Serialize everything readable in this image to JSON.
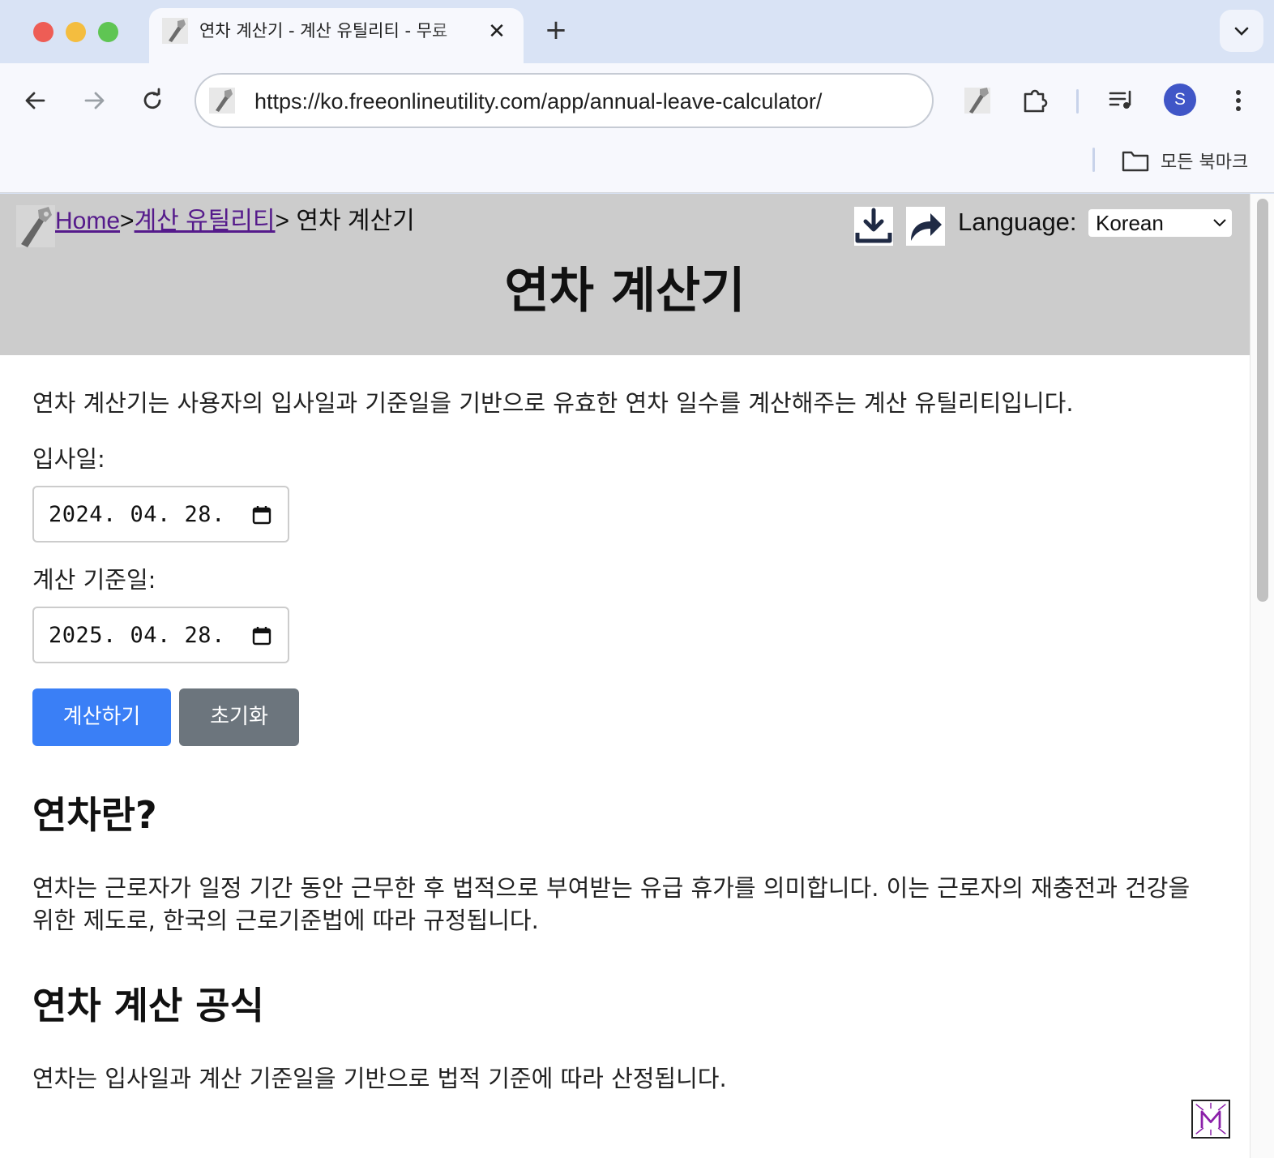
{
  "browser": {
    "tab_title": "연차 계산기 - 계산 유틸리티 - 무료",
    "tab_close": "✕",
    "new_tab": "+",
    "url": "https://ko.freeonlineutility.com/app/annual-leave-calculator/",
    "profile_initial": "S",
    "bookmarks_label": "모든 북마크"
  },
  "header": {
    "breadcrumb": {
      "home": "Home",
      "sep1": ">",
      "category": "계산 유틸리티",
      "sep2": ">",
      "current": " 연차 계산기"
    },
    "language_label": "Language:",
    "language_selected": "Korean",
    "title": "연차 계산기"
  },
  "main": {
    "intro": "연차 계산기는 사용자의 입사일과 기준일을 기반으로 유효한 연차 일수를 계산해주는 계산 유틸리티입니다.",
    "hire_date_label": "입사일:",
    "hire_date_value": "2024. 04. 28.",
    "base_date_label": "계산 기준일:",
    "base_date_value": "2025. 04. 28.",
    "calculate_button": "계산하기",
    "reset_button": "초기화",
    "section1_heading": "연차란?",
    "section1_body": "연차는 근로자가 일정 기간 동안 근무한 후 법적으로 부여받는 유급 휴가를 의미합니다. 이는 근로자의 재충전과 건강을 위한 제도로, 한국의 근로기준법에 따라 규정됩니다.",
    "section2_heading": "연차 계산 공식",
    "section2_body": "연차는 입사일과 계산 기준일을 기반으로 법적 기준에 따라 산정됩니다."
  },
  "colors": {
    "header_bg": "#cccccc",
    "calc_button": "#3a7ff6",
    "reset_button": "#6c757d",
    "link_visited": "#551a8b",
    "avatar": "#4056c7"
  }
}
